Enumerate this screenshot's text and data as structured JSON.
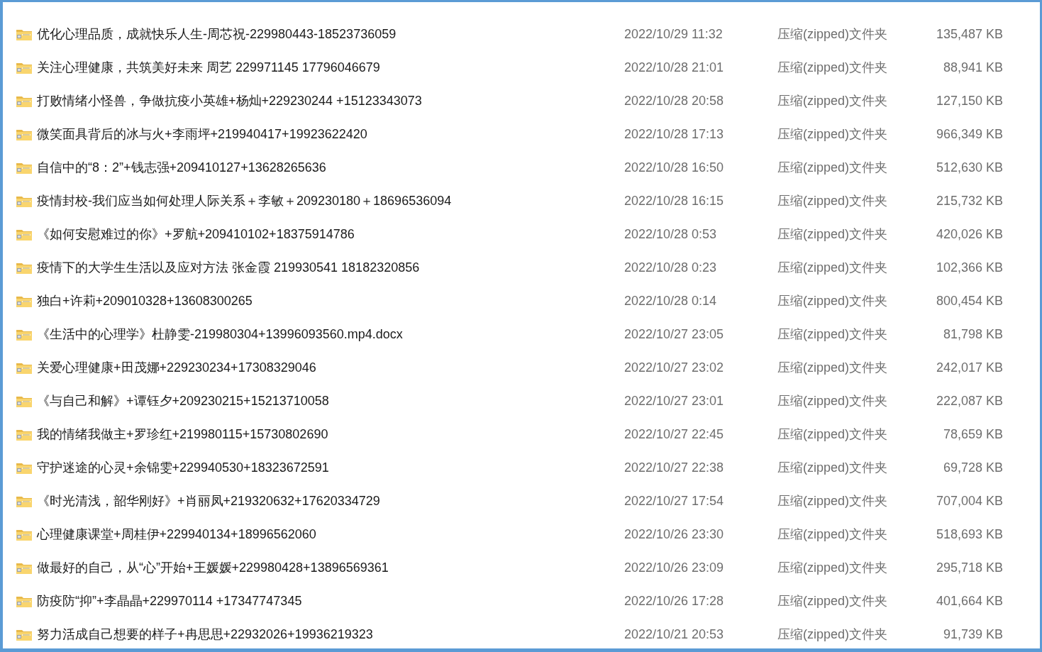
{
  "files": [
    {
      "name": "优化心理品质，成就快乐人生-周芯祝-229980443-18523736059",
      "modified": "2022/10/29 11:32",
      "type": "压缩(zipped)文件夹",
      "size": "135,487 KB"
    },
    {
      "name": "关注心理健康，共筑美好未来 周艺 229971145 17796046679",
      "modified": "2022/10/28 21:01",
      "type": "压缩(zipped)文件夹",
      "size": "88,941 KB"
    },
    {
      "name": "打败情绪小怪兽，争做抗疫小英雄+杨灿+229230244 +15123343073",
      "modified": "2022/10/28 20:58",
      "type": "压缩(zipped)文件夹",
      "size": "127,150 KB"
    },
    {
      "name": "微笑面具背后的冰与火+李雨坪+219940417+19923622420",
      "modified": "2022/10/28 17:13",
      "type": "压缩(zipped)文件夹",
      "size": "966,349 KB"
    },
    {
      "name": "自信中的“8：2”+钱志强+209410127+13628265636",
      "modified": "2022/10/28 16:50",
      "type": "压缩(zipped)文件夹",
      "size": "512,630 KB"
    },
    {
      "name": "疫情封校-我们应当如何处理人际关系＋李敏＋209230180＋18696536094",
      "modified": "2022/10/28 16:15",
      "type": "压缩(zipped)文件夹",
      "size": "215,732 KB"
    },
    {
      "name": "《如何安慰难过的你》+罗航+209410102+18375914786",
      "modified": "2022/10/28 0:53",
      "type": "压缩(zipped)文件夹",
      "size": "420,026 KB"
    },
    {
      "name": "疫情下的大学生生活以及应对方法 张金霞 219930541 18182320856",
      "modified": "2022/10/28 0:23",
      "type": "压缩(zipped)文件夹",
      "size": "102,366 KB"
    },
    {
      "name": "独白+许莉+209010328+13608300265",
      "modified": "2022/10/28 0:14",
      "type": "压缩(zipped)文件夹",
      "size": "800,454 KB"
    },
    {
      "name": "《生活中的心理学》杜静雯-219980304+13996093560.mp4.docx",
      "modified": "2022/10/27 23:05",
      "type": "压缩(zipped)文件夹",
      "size": "81,798 KB"
    },
    {
      "name": "关爱心理健康+田茂娜+229230234+17308329046",
      "modified": "2022/10/27 23:02",
      "type": "压缩(zipped)文件夹",
      "size": "242,017 KB"
    },
    {
      "name": "《与自己和解》+谭钰夕+209230215+15213710058",
      "modified": "2022/10/27 23:01",
      "type": "压缩(zipped)文件夹",
      "size": "222,087 KB"
    },
    {
      "name": "我的情绪我做主+罗珍红+219980115+15730802690",
      "modified": "2022/10/27 22:45",
      "type": "压缩(zipped)文件夹",
      "size": "78,659 KB"
    },
    {
      "name": "守护迷途的心灵+余锦雯+229940530+18323672591",
      "modified": "2022/10/27 22:38",
      "type": "压缩(zipped)文件夹",
      "size": "69,728 KB"
    },
    {
      "name": "《时光清浅，韶华刚好》+肖丽凤+219320632+17620334729",
      "modified": "2022/10/27 17:54",
      "type": "压缩(zipped)文件夹",
      "size": "707,004 KB"
    },
    {
      "name": "心理健康课堂+周桂伊+229940134+18996562060",
      "modified": "2022/10/26 23:30",
      "type": "压缩(zipped)文件夹",
      "size": "518,693 KB"
    },
    {
      "name": "做最好的自己，从“心”开始+王媛媛+229980428+13896569361",
      "modified": "2022/10/26 23:09",
      "type": "压缩(zipped)文件夹",
      "size": "295,718 KB"
    },
    {
      "name": "防疫防“抑”+李晶晶+229970114 +17347747345",
      "modified": "2022/10/26 17:28",
      "type": "压缩(zipped)文件夹",
      "size": "401,664 KB"
    },
    {
      "name": "努力活成自己想要的样子+冉思思+22932026+19936219323",
      "modified": "2022/10/21 20:53",
      "type": "压缩(zipped)文件夹",
      "size": "91,739 KB"
    }
  ]
}
